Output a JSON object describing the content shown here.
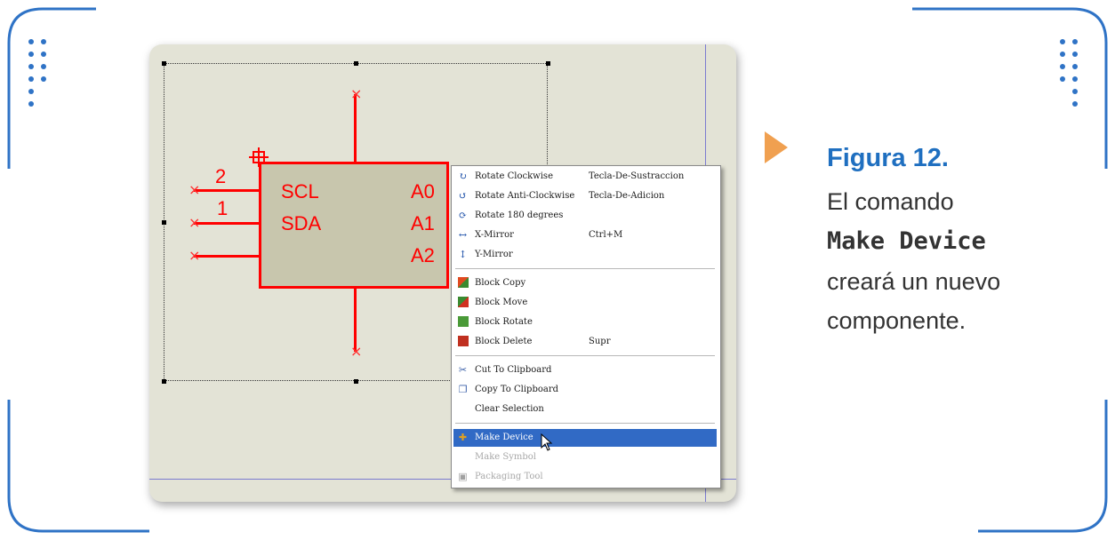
{
  "schematic": {
    "chip": {
      "pins_left": [
        "SCL",
        "SDA"
      ],
      "pins_right": [
        "A0",
        "A1",
        "A2"
      ],
      "pin_numbers": [
        "2",
        "1"
      ]
    }
  },
  "context_menu": {
    "items": [
      {
        "label": "Rotate Clockwise",
        "shortcut": "Tecla-De-Sustraccion",
        "icon": "rotate-clockwise-icon",
        "glyph": "↻",
        "color": "#1c4fa8"
      },
      {
        "label": "Rotate Anti-Clockwise",
        "shortcut": "Tecla-De-Adicion",
        "icon": "rotate-anticlockwise-icon",
        "glyph": "↺",
        "color": "#1c4fa8"
      },
      {
        "label": "Rotate 180 degrees",
        "shortcut": "",
        "icon": "rotate-180-icon",
        "glyph": "⟳",
        "color": "#1c4fa8"
      },
      {
        "label": "X-Mirror",
        "shortcut": "Ctrl+M",
        "icon": "x-mirror-icon",
        "glyph": "↔",
        "color": "#1c4fa8"
      },
      {
        "label": "Y-Mirror",
        "shortcut": "",
        "icon": "y-mirror-icon",
        "glyph": "↕",
        "color": "#1c4fa8"
      },
      {
        "label": "Block Copy",
        "shortcut": "",
        "icon": "block-copy-icon",
        "glyph": "",
        "color": "#d04020"
      },
      {
        "label": "Block Move",
        "shortcut": "",
        "icon": "block-move-icon",
        "glyph": "",
        "color": "#c83020"
      },
      {
        "label": "Block Rotate",
        "shortcut": "",
        "icon": "block-rotate-icon",
        "glyph": "",
        "color": "#3a8a30"
      },
      {
        "label": "Block Delete",
        "shortcut": "Supr",
        "icon": "block-delete-icon",
        "glyph": "",
        "color": "#b02818"
      },
      {
        "label": "Cut To Clipboard",
        "shortcut": "",
        "icon": "scissors-icon",
        "glyph": "✂",
        "color": "#3a5fa8"
      },
      {
        "label": "Copy To Clipboard",
        "shortcut": "",
        "icon": "copy-icon",
        "glyph": "❐",
        "color": "#3a5fa8"
      },
      {
        "label": "Clear Selection",
        "shortcut": "",
        "icon": "",
        "glyph": "",
        "color": ""
      },
      {
        "label": "Make Device",
        "shortcut": "",
        "icon": "make-device-icon",
        "glyph": "✚",
        "color": "#e0a020"
      },
      {
        "label": "Make Symbol",
        "shortcut": "",
        "icon": "",
        "glyph": "",
        "color": ""
      },
      {
        "label": "Packaging Tool",
        "shortcut": "",
        "icon": "packaging-tool-icon",
        "glyph": "▣",
        "color": "#a0a0a0"
      }
    ]
  },
  "caption": {
    "title": "Figura 12.",
    "line1": "El comando",
    "command": "Make Device",
    "line2": "creará un nuevo",
    "line3": "componente."
  }
}
